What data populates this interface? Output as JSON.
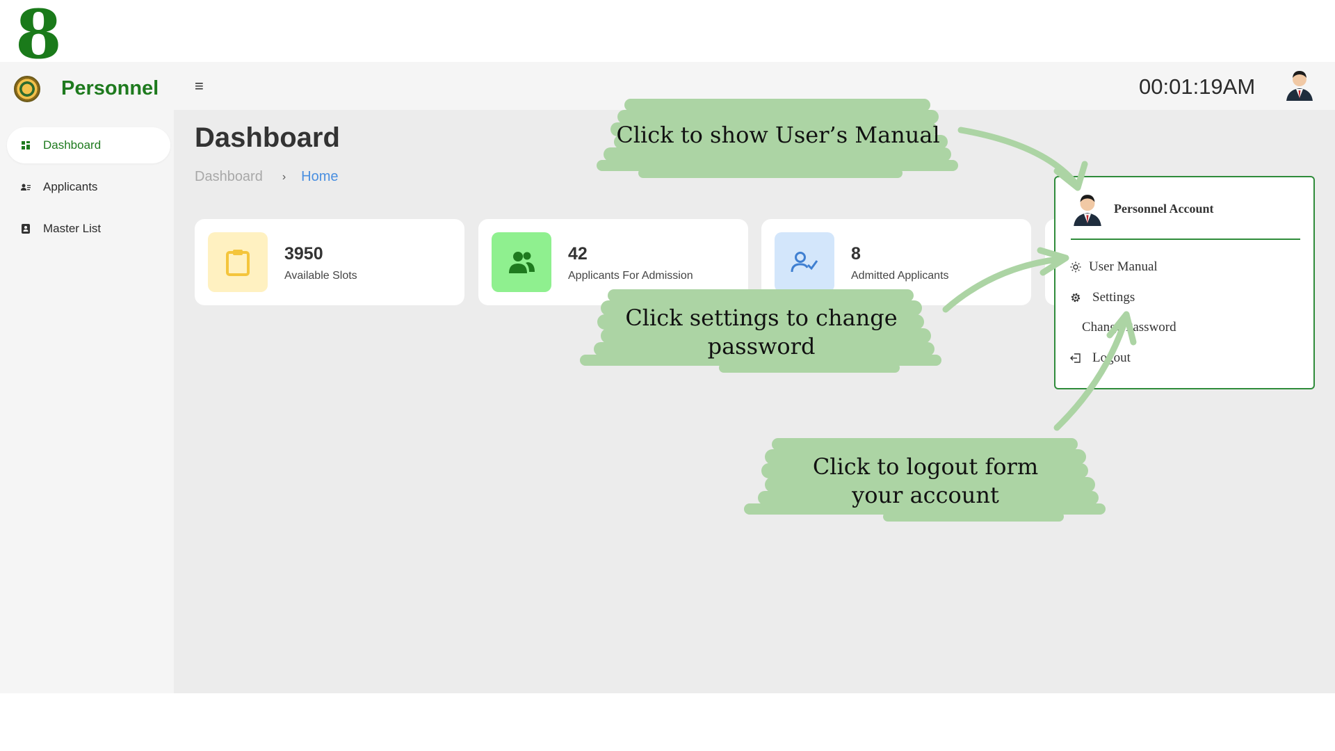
{
  "step_number": "8",
  "app": {
    "name": "Personnel",
    "clock": "00:01:19AM"
  },
  "sidebar": {
    "items": [
      {
        "label": "Dashboard",
        "icon": "dashboard-icon",
        "active": true
      },
      {
        "label": "Applicants",
        "icon": "applicants-icon",
        "active": false
      },
      {
        "label": "Master List",
        "icon": "master-list-icon",
        "active": false
      }
    ]
  },
  "page": {
    "title": "Dashboard",
    "breadcrumb": [
      "Dashboard",
      "Home"
    ]
  },
  "cards": [
    {
      "value": "3950",
      "label": "Available Slots",
      "icon": "clipboard-icon"
    },
    {
      "value": "42",
      "label": "Applicants For Admission",
      "icon": "users-icon"
    },
    {
      "value": "8",
      "label": "Admitted Applicants",
      "icon": "user-check-icon"
    }
  ],
  "dropdown": {
    "title": "Personnel Account",
    "items": [
      {
        "label": "User Manual",
        "icon": "sun-icon"
      },
      {
        "label": "Settings",
        "icon": "gear-icon"
      },
      {
        "label": "Change Password",
        "icon": ""
      },
      {
        "label": "Logout",
        "icon": "logout-icon"
      }
    ]
  },
  "callouts": {
    "manual": "Click to show User’s Manual",
    "settings_line1": "Click settings to change",
    "settings_line2": "password",
    "logout_line1": "Click to logout form",
    "logout_line2": "your account"
  },
  "colors": {
    "brand_green": "#1e7a1e",
    "accent_border": "#2e8b3a",
    "brush_green": "#acd4a4",
    "link_blue": "#4a8fe0"
  }
}
